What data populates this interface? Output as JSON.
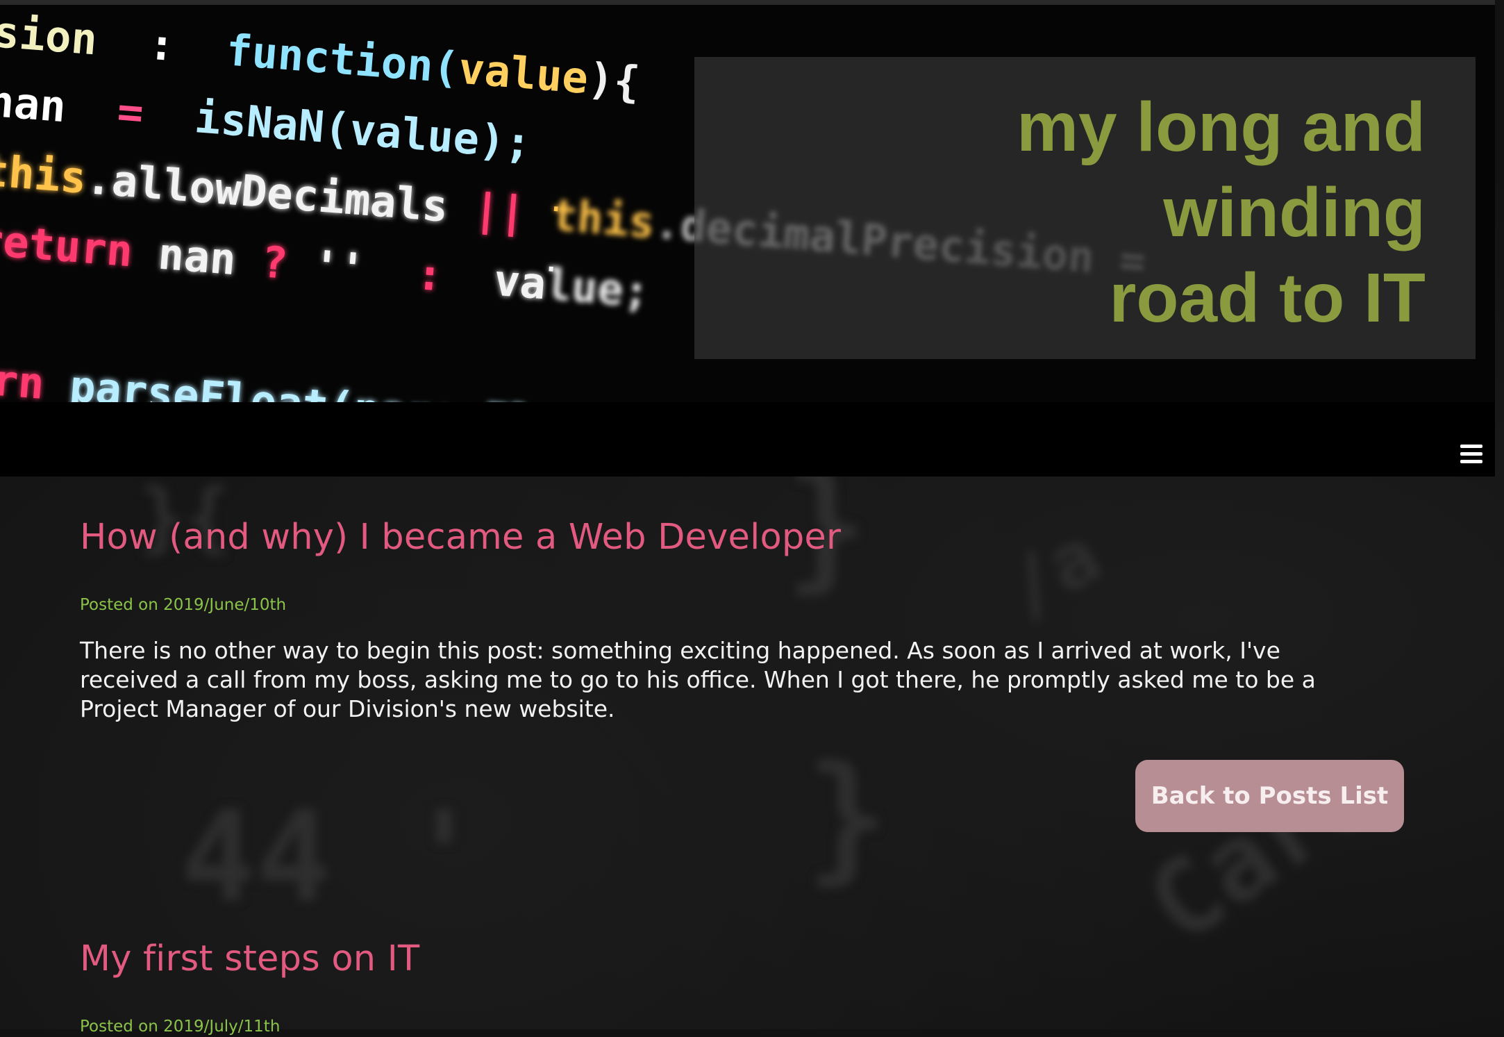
{
  "header": {
    "site_title_lines": [
      "my long and",
      "winding",
      "road to IT"
    ],
    "code_lines": [
      {
        "parts": [
          {
            "t": "sion",
            "c": "#f3f0c0"
          },
          {
            "t": "  :  ",
            "c": "#ffffff"
          },
          {
            "t": "function(",
            "c": "#8fe3ff"
          },
          {
            "t": "value",
            "c": "#ffd060"
          },
          {
            "t": "){",
            "c": "#f0f0f0"
          }
        ]
      },
      {
        "parts": [
          {
            "t": "nan",
            "c": "#ffffff"
          },
          {
            "t": "  =  ",
            "c": "#ff4f8a"
          },
          {
            "t": "isNaN(value);",
            "c": "#b8ecff"
          }
        ]
      },
      {
        "parts": [
          {
            "t": "this",
            "c": "#ffc24a"
          },
          {
            "t": ".allowDecimals ",
            "c": "#f2f2f2"
          },
          {
            "t": "|| ",
            "c": "#ff3a6e"
          },
          {
            "t": "this",
            "c": "#ffc24a"
          },
          {
            "t": ".decimalPrecision = ",
            "c": "#b0b0b0"
          }
        ]
      },
      {
        "parts": [
          {
            "t": "return",
            "c": "#ff3a6e"
          },
          {
            "t": " nan ",
            "c": "#f2f2f2"
          },
          {
            "t": "? ",
            "c": "#ff3a6e"
          },
          {
            "t": "''",
            "c": "#f2f2f2"
          },
          {
            "t": "  :  ",
            "c": "#ff3a6e"
          },
          {
            "t": "value;",
            "c": "#f2f2f2"
          }
        ]
      },
      {
        "parts": [
          {
            "t": " ",
            "c": "#ffffff"
          }
        ]
      },
      {
        "parts": [
          {
            "t": "urn",
            "c": "#ff3a6e"
          },
          {
            "t": " parseFloat(parseFloat(value)",
            "c": "#b8ecff"
          }
        ]
      }
    ],
    "colors": {
      "title": "#8a9a3e",
      "post_title": "#e25a7f",
      "post_date": "#8bc34a",
      "button_bg": "#b78e93"
    },
    "menu_icon": "hamburger-menu-icon"
  },
  "posts": [
    {
      "title": "How (and why) I became a Web Developer",
      "date": "Posted on 2019/June/10th",
      "excerpt": "There is no other way to begin this post: something exciting happened. As soon as I arrived at work, I've received a call from my boss, asking me to go to his office. When I got there, he promptly asked me to be a Project Manager of our Division's new website.",
      "button_label": "Back to Posts List"
    },
    {
      "title": "My first steps on IT",
      "date": "Posted on 2019/July/11th"
    }
  ]
}
